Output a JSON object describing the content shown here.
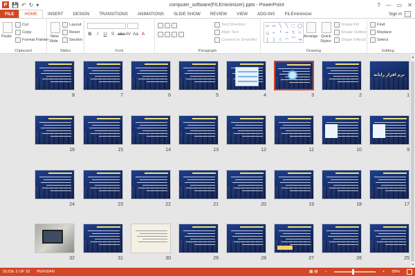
{
  "window": {
    "title": "computer_software(FILEminimizer).pptx - PowerPoint",
    "help": "?",
    "minimize": "—",
    "restore": "▭",
    "close": "✕"
  },
  "qat": {
    "app_letter": "P",
    "save": "💾",
    "undo": "↶",
    "redo": "↻",
    "customize": "▾"
  },
  "tabs": [
    {
      "label": "FILE"
    },
    {
      "label": "HOME"
    },
    {
      "label": "INSERT"
    },
    {
      "label": "DESIGN"
    },
    {
      "label": "TRANSITIONS"
    },
    {
      "label": "ANIMATIONS"
    },
    {
      "label": "SLIDE SHOW"
    },
    {
      "label": "REVIEW"
    },
    {
      "label": "VIEW"
    },
    {
      "label": "ADD-INS"
    },
    {
      "label": "FILEminimizer"
    }
  ],
  "signin": {
    "label": "Sign in"
  },
  "ribbon": {
    "clipboard": {
      "label": "Clipboard",
      "paste": "Paste",
      "cut": "Cut",
      "copy": "Copy",
      "format_painter": "Format Painter"
    },
    "slides": {
      "label": "Slides",
      "new_slide": "New",
      "new_slide2": "Slide",
      "layout": "Layout",
      "reset": "Reset",
      "section": "Section"
    },
    "font": {
      "label": "Font",
      "bold": "B",
      "italic": "I",
      "underline": "U",
      "shadow": "S",
      "strike": "abc",
      "spacing": "AV",
      "case": "Aa",
      "color": "A"
    },
    "paragraph": {
      "label": "Paragraph",
      "text_direction": "Text Direction",
      "align_text": "Align Text",
      "smartart": "Convert to SmartArt"
    },
    "drawing": {
      "label": "Drawing",
      "arrange": "Arrange",
      "quick_styles": "Quick",
      "quick_styles2": "Styles",
      "shape_fill": "Shape Fill",
      "shape_outline": "Shape Outline",
      "shape_effects": "Shape Effects"
    },
    "editing": {
      "label": "Editing",
      "find": "Find",
      "replace": "Replace",
      "select": "Select"
    },
    "shapes": [
      "▭",
      "▭",
      "╲",
      "╲",
      "⬚",
      "◯",
      "△",
      "⌐",
      "╰",
      "⇨",
      "⇧",
      "☆",
      "{",
      "}",
      "☆",
      "◠",
      "⌒",
      "↝"
    ]
  },
  "slides": {
    "selected": 3,
    "cover_title": "نرم افزار رایانه",
    "rows": [
      [
        8,
        7,
        6,
        5,
        4,
        3,
        2,
        1
      ],
      [
        16,
        15,
        14,
        13,
        12,
        11,
        10,
        9
      ],
      [
        24,
        23,
        22,
        21,
        20,
        19,
        18,
        17
      ],
      [
        32,
        31,
        30,
        29,
        28,
        27,
        26,
        25
      ]
    ]
  },
  "status": {
    "slide_info": "SLIDE 3 OF 32",
    "language": "PERSIAN",
    "zoom": "58%",
    "zoom_minus": "−",
    "zoom_plus": "+",
    "views": "▦ ▤"
  }
}
